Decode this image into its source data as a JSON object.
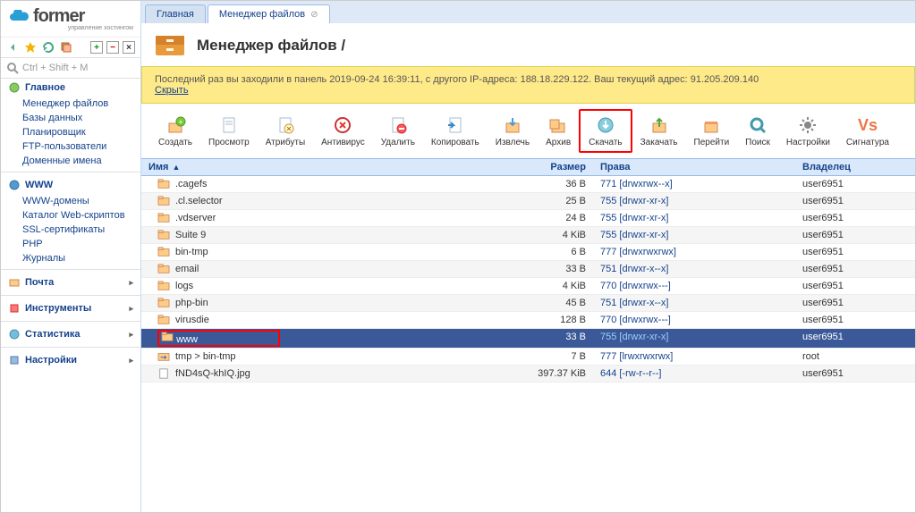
{
  "brand": {
    "name": "former",
    "subtitle": "управление хостингом"
  },
  "search": {
    "placeholder": "Ctrl + Shift + M"
  },
  "sidebar": {
    "sections": [
      {
        "label": "Главное",
        "items": [
          "Менеджер файлов",
          "Базы данных",
          "Планировщик",
          "FTP-пользователи",
          "Доменные имена"
        ]
      },
      {
        "label": "WWW",
        "items": [
          "WWW-домены",
          "Каталог Web-скриптов",
          "SSL-сертификаты",
          "PHP",
          "Журналы"
        ]
      },
      {
        "label": "Почта",
        "items": []
      },
      {
        "label": "Инструменты",
        "items": []
      },
      {
        "label": "Статистика",
        "items": []
      },
      {
        "label": "Настройки",
        "items": []
      }
    ]
  },
  "tabs": [
    {
      "label": "Главная",
      "active": false,
      "closable": false
    },
    {
      "label": "Менеджер файлов",
      "active": true,
      "closable": true
    }
  ],
  "title": "Менеджер файлов /",
  "notice": {
    "text": "Последний раз вы заходили в панель 2019-09-24 16:39:11, с другого IP-адреса: 188.18.229.122. Ваш текущий адрес: 91.205.209.140",
    "hide": "Скрыть"
  },
  "toolbar": [
    "Создать",
    "Просмотр",
    "Атрибуты",
    "Антивирус",
    "Удалить",
    "Копировать",
    "Извлечь",
    "Архив",
    "Скачать",
    "Закачать",
    "Перейти",
    "Поиск",
    "Настройки",
    "Сигнатура"
  ],
  "highlightedTool": 8,
  "columns": {
    "name": "Имя",
    "size": "Размер",
    "perm": "Права",
    "owner": "Владелец"
  },
  "rows": [
    {
      "type": "folder",
      "name": ".cagefs",
      "size": "36 B",
      "perm": "771 [drwxrwx--x]",
      "owner": "user6951"
    },
    {
      "type": "folder",
      "name": ".cl.selector",
      "size": "25 B",
      "perm": "755 [drwxr-xr-x]",
      "owner": "user6951"
    },
    {
      "type": "folder",
      "name": ".vdserver",
      "size": "24 B",
      "perm": "755 [drwxr-xr-x]",
      "owner": "user6951"
    },
    {
      "type": "folder",
      "name": "Suite 9",
      "size": "4 KiB",
      "perm": "755 [drwxr-xr-x]",
      "owner": "user6951"
    },
    {
      "type": "folder",
      "name": "bin-tmp",
      "size": "6 B",
      "perm": "777 [drwxrwxrwx]",
      "owner": "user6951"
    },
    {
      "type": "folder",
      "name": "email",
      "size": "33 B",
      "perm": "751 [drwxr-x--x]",
      "owner": "user6951"
    },
    {
      "type": "folder",
      "name": "logs",
      "size": "4 KiB",
      "perm": "770 [drwxrwx---]",
      "owner": "user6951"
    },
    {
      "type": "folder",
      "name": "php-bin",
      "size": "45 B",
      "perm": "751 [drwxr-x--x]",
      "owner": "user6951"
    },
    {
      "type": "folder",
      "name": "virusdie",
      "size": "128 B",
      "perm": "770 [drwxrwx---]",
      "owner": "user6951"
    },
    {
      "type": "folder",
      "name": "www",
      "size": "33 B",
      "perm": "755 [drwxr-xr-x]",
      "owner": "user6951",
      "selected": true,
      "redbox": true
    },
    {
      "type": "link",
      "name": "tmp > bin-tmp",
      "size": "7 B",
      "perm": "777 [lrwxrwxrwx]",
      "owner": "root"
    },
    {
      "type": "file",
      "name": "fND4sQ-khIQ.jpg",
      "size": "397.37 KiB",
      "perm": "644 [-rw-r--r--]",
      "owner": "user6951"
    }
  ]
}
